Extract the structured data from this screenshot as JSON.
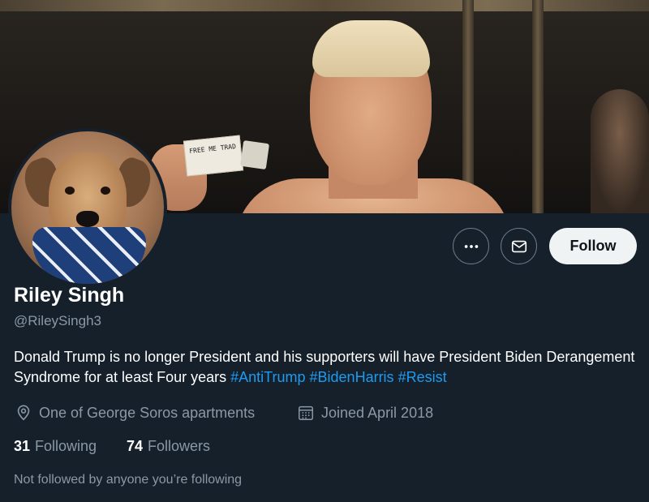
{
  "profile": {
    "name": "Riley Singh",
    "handle": "@RileySingh3",
    "bio_text": "Donald Trump is no longer President and his supporters will have President Biden Derangement Syndrome for at least Four years",
    "bio_hashtags": [
      "#AntiTrump",
      "#BidenHarris",
      "#Resist"
    ],
    "location": "One of George Soros apartments",
    "joined": "Joined April 2018",
    "following_count": "31",
    "following_label": "Following",
    "followers_count": "74",
    "followers_label": "Followers",
    "not_followed_note": "Not followed by anyone you’re following"
  },
  "banner": {
    "sign_text": "FREE ME TRAD"
  },
  "actions": {
    "more_icon": "more-horizontal-icon",
    "message_icon": "envelope-icon",
    "follow_label": "Follow"
  },
  "colors": {
    "background": "#15202b",
    "accent": "#1d9bf0",
    "secondary_text": "#8b98a5"
  }
}
